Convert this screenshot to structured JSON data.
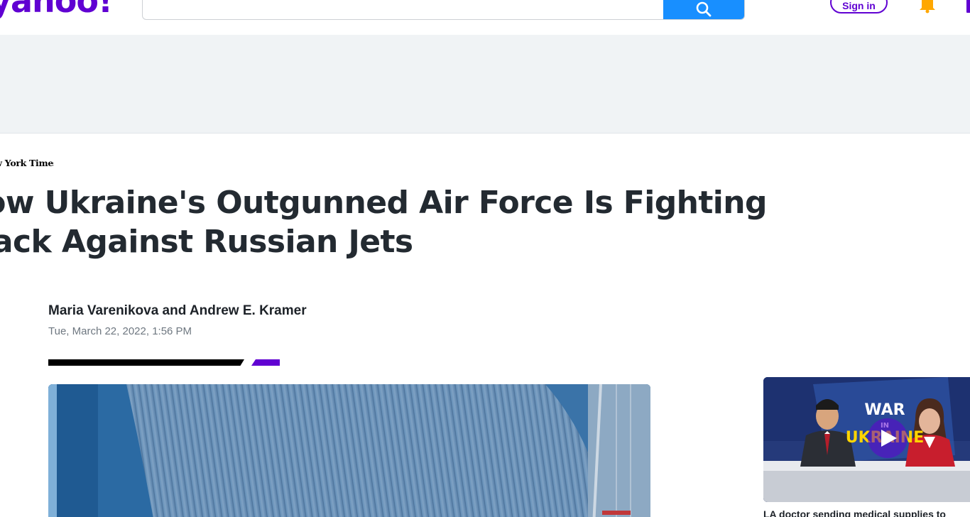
{
  "header": {
    "logo_text": "yahoo!",
    "search_placeholder": "",
    "signin_label": "Sign in",
    "icons": [
      "search-icon",
      "bell-icon",
      "mail-icon"
    ]
  },
  "article": {
    "publisher": "The New York Times",
    "headline_line1": "How Ukraine's Outgunned Air Force Is Fighting",
    "headline_line2": "Back Against Russian Jets",
    "author": "Maria Varenikova and Andrew E. Kramer",
    "date": "Tue, March 22, 2022, 1:56 PM"
  },
  "right_rail": {
    "video_badge_line1": "WAR",
    "video_badge_line2": "IN",
    "video_badge_line3": "UKRAINE",
    "video_caption": "LA doctor sending medical supplies to"
  },
  "colors": {
    "brand_purple": "#6001d2",
    "search_blue": "#188fff",
    "headline": "#232a31",
    "ad_band": "#f0f3f5"
  }
}
